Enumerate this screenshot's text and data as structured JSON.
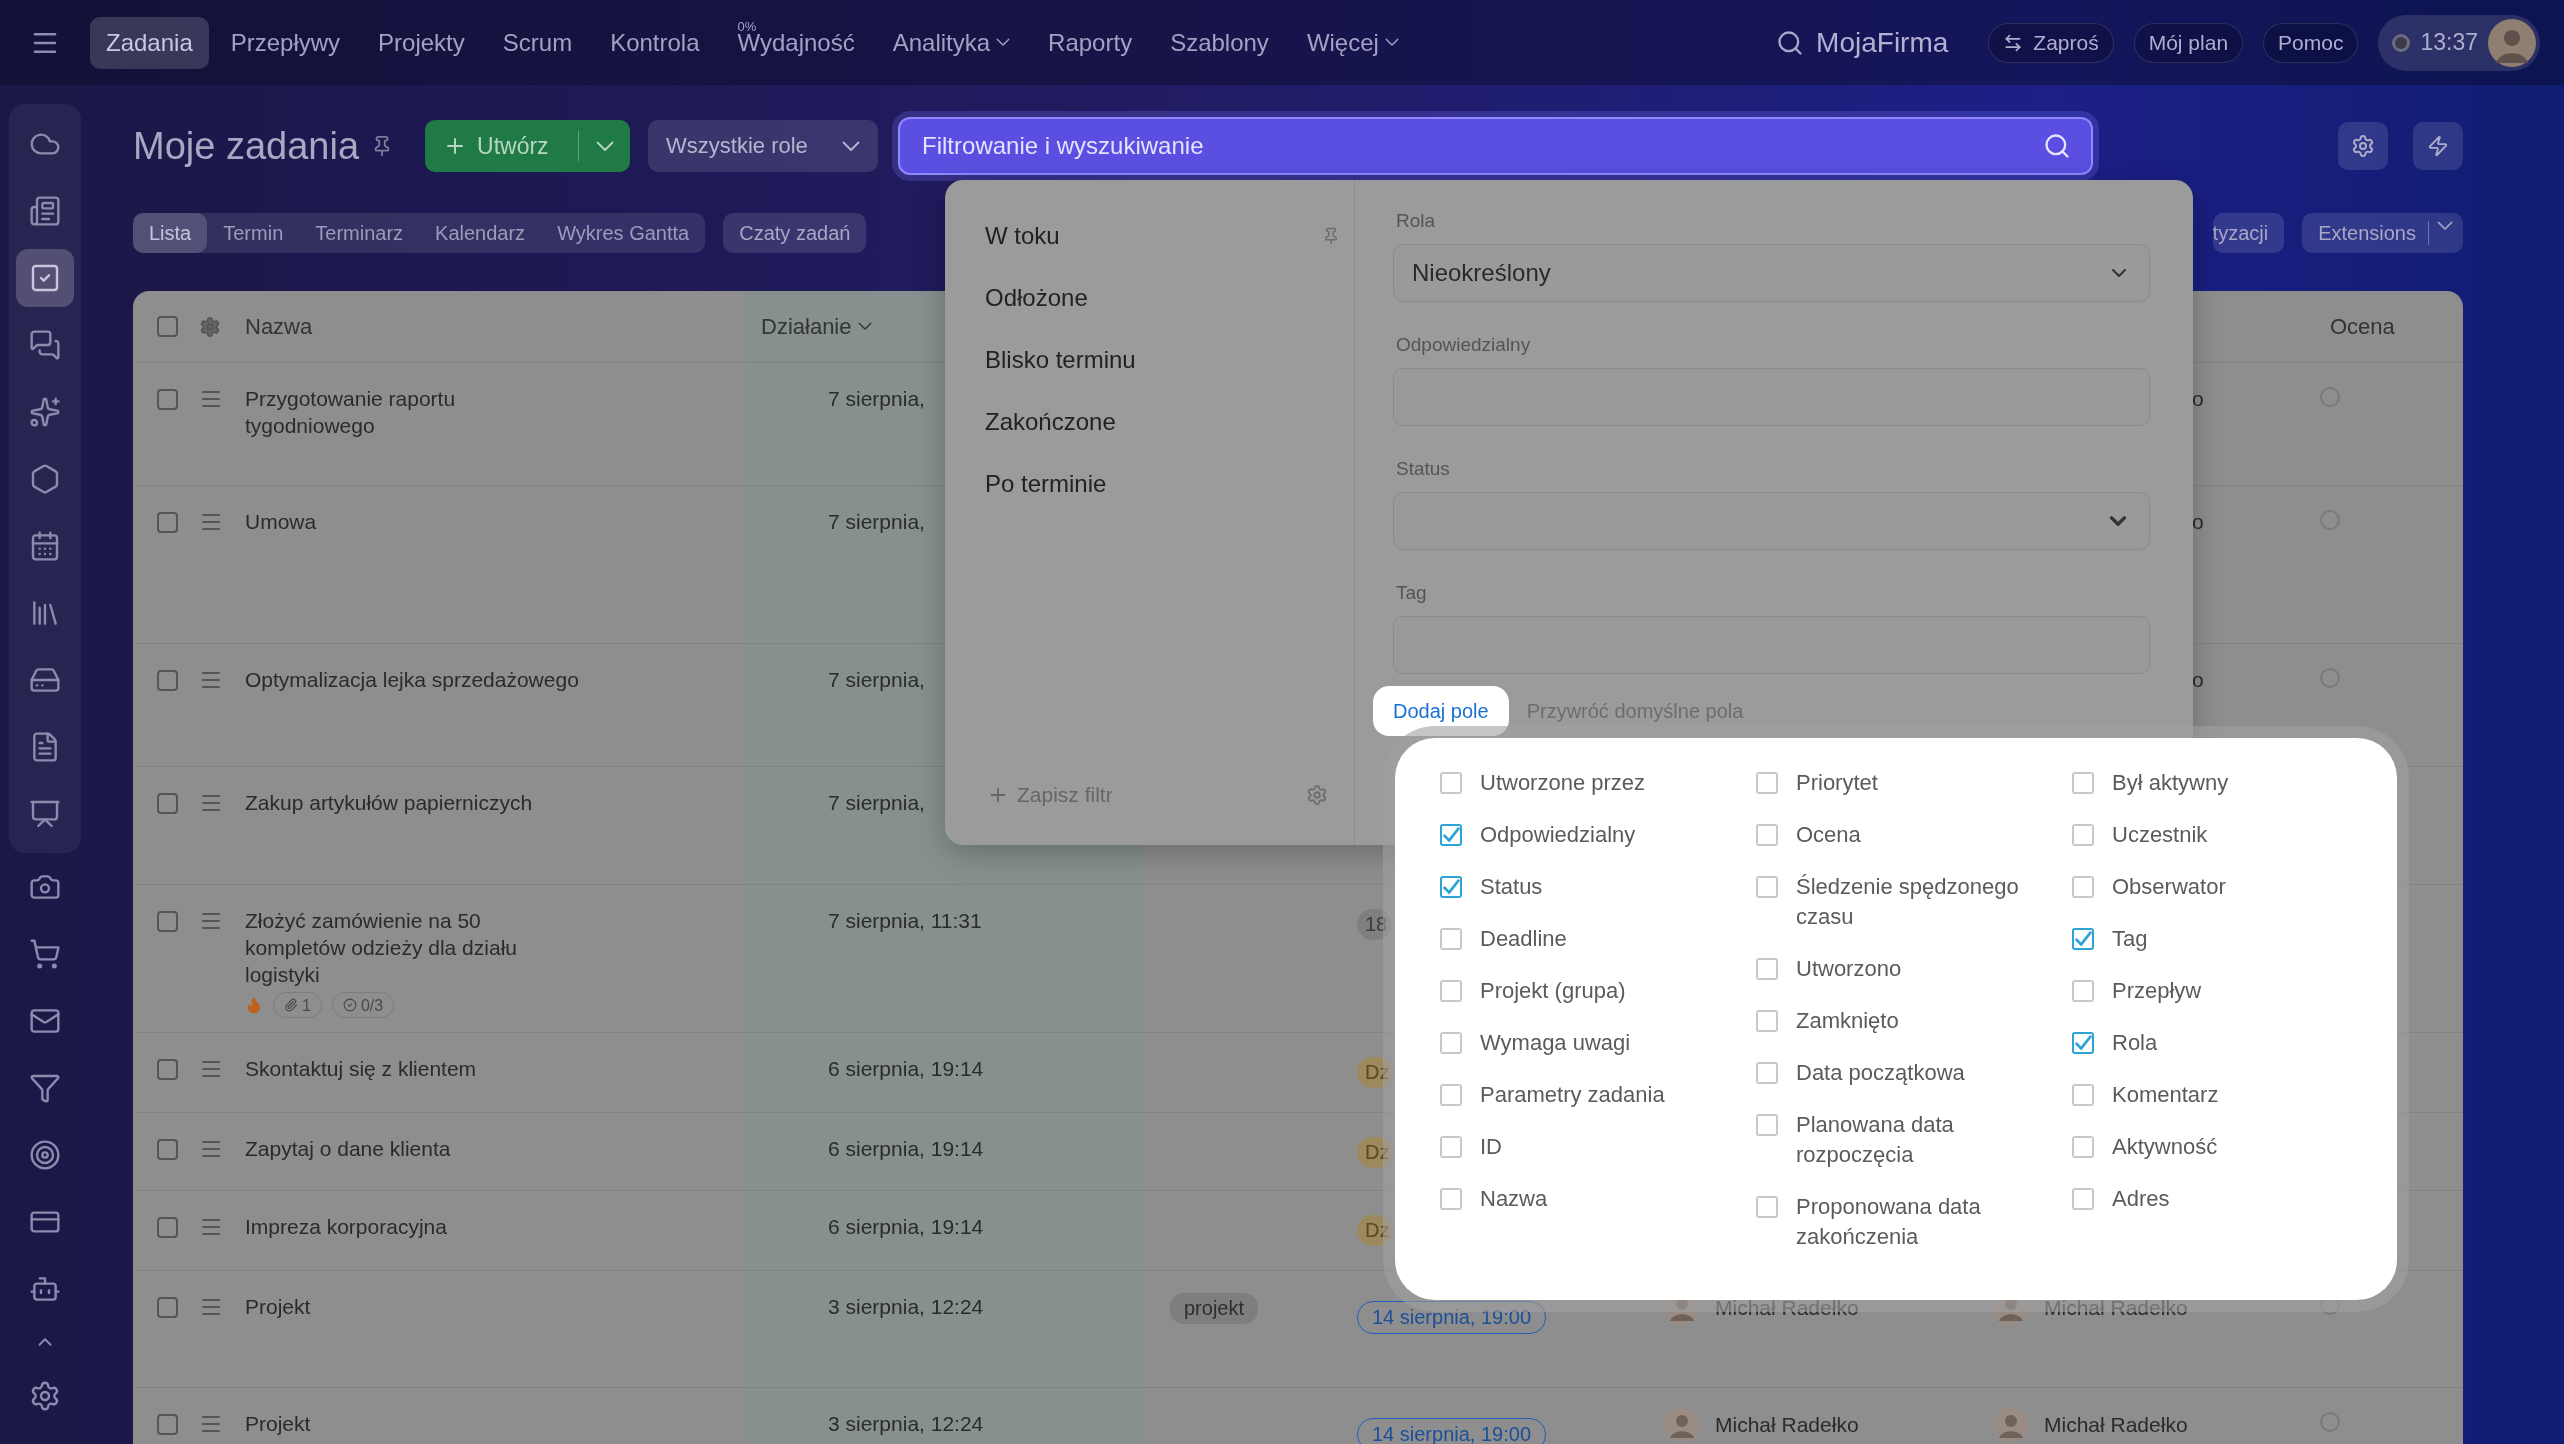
{
  "top_nav": {
    "items": [
      {
        "label": "Zadania",
        "selected": true
      },
      {
        "label": "Przepływy",
        "selected": false
      },
      {
        "label": "Projekty",
        "selected": false
      },
      {
        "label": "Scrum",
        "selected": false
      },
      {
        "label": "Kontrola",
        "selected": false
      },
      {
        "label": "Wydajność",
        "selected": false,
        "badge": "0%"
      },
      {
        "label": "Analityka",
        "selected": false,
        "dropdown": true
      },
      {
        "label": "Raporty",
        "selected": false
      },
      {
        "label": "Szablony",
        "selected": false
      },
      {
        "label": "Więcej",
        "selected": false,
        "dropdown": true
      }
    ],
    "company": "MojaFirma",
    "invite_button": "Zaproś",
    "buttons": [
      "Mój plan",
      "Pomoc"
    ],
    "clock": "13:37"
  },
  "sidebar": {
    "items": [
      {
        "selected": false
      },
      {
        "selected": false
      },
      {
        "selected": true
      },
      {
        "selected": false
      },
      {
        "selected": false
      },
      {
        "selected": false
      },
      {
        "selected": false
      },
      {
        "selected": false
      },
      {
        "selected": false
      },
      {
        "selected": false
      },
      {
        "selected": false
      },
      {
        "selected": false
      },
      {
        "selected": false
      },
      {
        "selected": false
      },
      {
        "selected": false
      },
      {
        "selected": false
      },
      {
        "selected": false
      },
      {
        "selected": false
      }
    ]
  },
  "header": {
    "title": "Moje zadania",
    "create_button": "Utwórz",
    "role_select": "Wszystkie role",
    "search": {
      "placeholder": "Filtrowanie i wyszukiwanie"
    }
  },
  "view_tabs": [
    {
      "label": "Lista",
      "selected": true
    },
    {
      "label": "Termin",
      "selected": false
    },
    {
      "label": "Terminarz",
      "selected": false
    },
    {
      "label": "Kalendarz",
      "selected": false
    },
    {
      "label": "Wykres Gantta",
      "selected": false
    }
  ],
  "chat_button": "Czaty zadań",
  "cut_button": "tyzacji",
  "extensions_button": "Extensions",
  "table": {
    "columns": [
      "Nazwa",
      "Działanie"
    ],
    "last_column": "Ocena",
    "all_checked": false,
    "rows": [
      {
        "checked": false,
        "name": "Przygotowanie raportu tygodniowego",
        "action": "7 sierpnia,",
        "creator_tail": "o",
        "rated": false
      },
      {
        "checked": false,
        "name": "Umowa",
        "action": "7 sierpnia,",
        "creator_tail": "o",
        "rated": false
      },
      {
        "checked": false,
        "name": "Optymalizacja lejka sprzedażowego",
        "action": "7 sierpnia,",
        "creator_tail": "o",
        "rated": false
      },
      {
        "checked": false,
        "name": "Zakup artykułów papierniczych",
        "action": "7 sierpnia,"
      },
      {
        "checked": false,
        "name": "Złożyć zamówienie na 50 kompletów odzieży dla działu logistyki",
        "urgent": true,
        "attachments": "1",
        "checklist": "0/3",
        "action": "7 sierpnia, 11:31",
        "deadline": {
          "text": "18",
          "kind": "plain"
        }
      },
      {
        "checked": false,
        "name": "Skontaktuj się z klientem",
        "action": "6 sierpnia, 19:14",
        "deadline": {
          "text": "Dz",
          "kind": "warning"
        }
      },
      {
        "checked": false,
        "name": "Zapytaj o dane klienta",
        "action": "6 sierpnia, 19:14",
        "deadline": {
          "text": "Dz",
          "kind": "warning"
        }
      },
      {
        "checked": false,
        "name": "Impreza korporacyjna",
        "action": "6 sierpnia, 19:14",
        "deadline": {
          "text": "Dz",
          "kind": "warning"
        }
      },
      {
        "checked": false,
        "name": "Projekt",
        "action": "3 sierpnia, 12:24",
        "tag": "projekt",
        "deadline": {
          "text": "14 sierpnia, 19:00",
          "kind": "date"
        },
        "responsible": "Michał Radełko",
        "creator": "Michał Radełko",
        "rated": false
      },
      {
        "checked": false,
        "name": "Projekt",
        "action": "3 sierpnia, 12:24",
        "deadline": {
          "text": "14 sierpnia, 19:00",
          "kind": "date"
        },
        "responsible": "Michał Radełko",
        "creator": "Michał Radełko",
        "rated": false
      }
    ]
  },
  "filter_panel": {
    "presets": [
      "W toku",
      "Odłożone",
      "Blisko terminu",
      "Zakończone",
      "Po terminie"
    ],
    "save_filter": "Zapisz filtr",
    "fields": [
      {
        "label": "Rola",
        "kind": "select",
        "value": "Nieokreślony"
      },
      {
        "label": "Odpowiedzialny",
        "kind": "text"
      },
      {
        "label": "Status",
        "kind": "select"
      },
      {
        "label": "Tag",
        "kind": "text"
      }
    ],
    "add_field_button": "Dodaj pole",
    "reset_link": "Przywróć domyślne pola"
  },
  "field_picker": {
    "columns": [
      [
        {
          "label": "Utworzone przez",
          "checked": false
        },
        {
          "label": "Odpowiedzialny",
          "checked": true
        },
        {
          "label": "Status",
          "checked": true
        },
        {
          "label": "Deadline",
          "checked": false
        },
        {
          "label": "Projekt (grupa)",
          "checked": false
        },
        {
          "label": "Wymaga uwagi",
          "checked": false
        },
        {
          "label": "Parametry zadania",
          "checked": false
        },
        {
          "label": "ID",
          "checked": false
        },
        {
          "label": "Nazwa",
          "checked": false
        }
      ],
      [
        {
          "label": "Priorytet",
          "checked": false
        },
        {
          "label": "Ocena",
          "checked": false
        },
        {
          "label": "Śledzenie spędzonego czasu",
          "checked": false
        },
        {
          "label": "Utworzono",
          "checked": false
        },
        {
          "label": "Zamknięto",
          "checked": false
        },
        {
          "label": "Data początkowa",
          "checked": false
        },
        {
          "label": "Planowana data rozpoczęcia",
          "checked": false
        },
        {
          "label": "Proponowana data zakończenia",
          "checked": false
        }
      ],
      [
        {
          "label": "Był aktywny",
          "checked": false
        },
        {
          "label": "Uczestnik",
          "checked": false
        },
        {
          "label": "Obserwator",
          "checked": false
        },
        {
          "label": "Tag",
          "checked": true
        },
        {
          "label": "Przepływ",
          "checked": false
        },
        {
          "label": "Rola",
          "checked": true
        },
        {
          "label": "Komentarz",
          "checked": false
        },
        {
          "label": "Aktywność",
          "checked": false
        },
        {
          "label": "Adres",
          "checked": false
        }
      ]
    ]
  }
}
